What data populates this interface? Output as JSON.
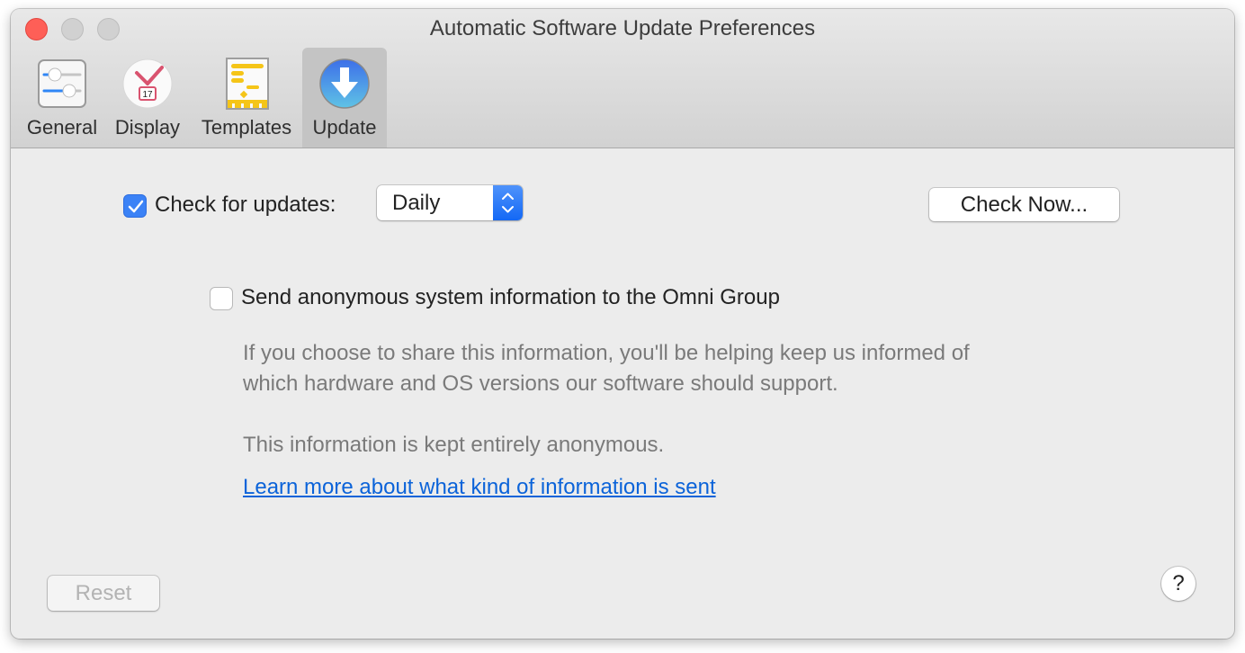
{
  "window": {
    "title": "Automatic Software Update Preferences"
  },
  "toolbar": {
    "tabs": [
      {
        "label": "General",
        "icon": "sliders-icon",
        "active": false
      },
      {
        "label": "Display",
        "icon": "clock-calendar-icon",
        "active": false
      },
      {
        "label": "Templates",
        "icon": "gantt-template-icon",
        "active": false
      },
      {
        "label": "Update",
        "icon": "download-arrow-icon",
        "active": true
      }
    ]
  },
  "update": {
    "check_label": "Check for updates:",
    "check_enabled": true,
    "frequency": "Daily",
    "check_now_label": "Check Now...",
    "send_info_label": "Send anonymous system information to the Omni Group",
    "send_info_enabled": false,
    "description_line1": "If you choose to share this information, you'll be helping keep us informed of",
    "description_line2": "which hardware and OS versions our software should support.",
    "anonymous_note": "This information is kept entirely anonymous.",
    "learn_more_link": "Learn more about what kind of information is sent"
  },
  "footer": {
    "reset_label": "Reset",
    "help_label": "?"
  },
  "colors": {
    "accent": "#3b82f6",
    "link": "#0b63d9",
    "close": "#fe5f57"
  }
}
